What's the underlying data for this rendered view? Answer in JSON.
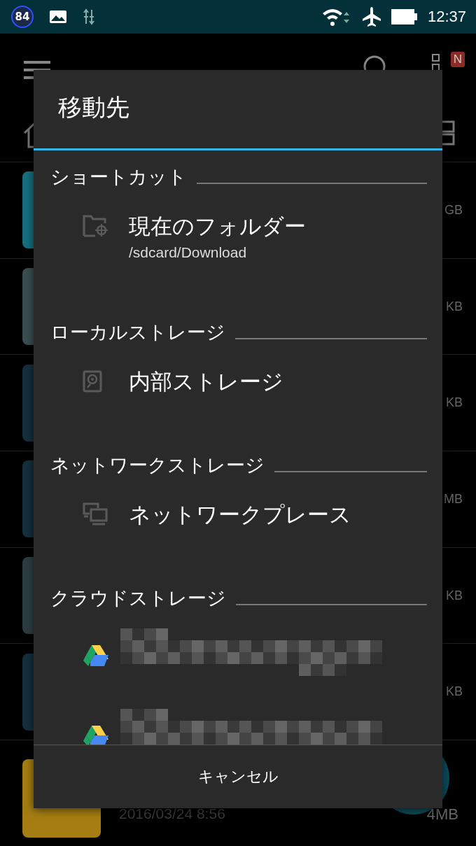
{
  "status_bar": {
    "notification_badge": "84",
    "time": "12:37"
  },
  "background": {
    "badge": "N",
    "rows": [
      {
        "size": "GB",
        "color": "#17707f"
      },
      {
        "size": "KB",
        "color": "#3a4f52"
      },
      {
        "size": "KB",
        "color": "#14303d"
      },
      {
        "size": "MB",
        "color": "#14303d"
      },
      {
        "size": "KB",
        "color": "#2c3e42"
      },
      {
        "size": "KB",
        "color": "#14303d"
      }
    ],
    "last_row": {
      "date": "2016/03/24 8:56",
      "size": "4MB"
    }
  },
  "dialog": {
    "title": "移動先",
    "sections": [
      {
        "header": "ショートカット",
        "items": [
          {
            "kind": "folder",
            "title": "現在のフォルダー",
            "subtitle": "/sdcard/Download"
          }
        ]
      },
      {
        "header": "ローカルストレージ",
        "items": [
          {
            "kind": "storage",
            "title": "内部ストレージ"
          }
        ]
      },
      {
        "header": "ネットワークストレージ",
        "items": [
          {
            "kind": "network",
            "title": "ネットワークプレース"
          }
        ]
      },
      {
        "header": "クラウドストレージ",
        "items": [
          {
            "kind": "drive"
          },
          {
            "kind": "drive"
          }
        ]
      }
    ],
    "cancel": "キャンセル"
  }
}
